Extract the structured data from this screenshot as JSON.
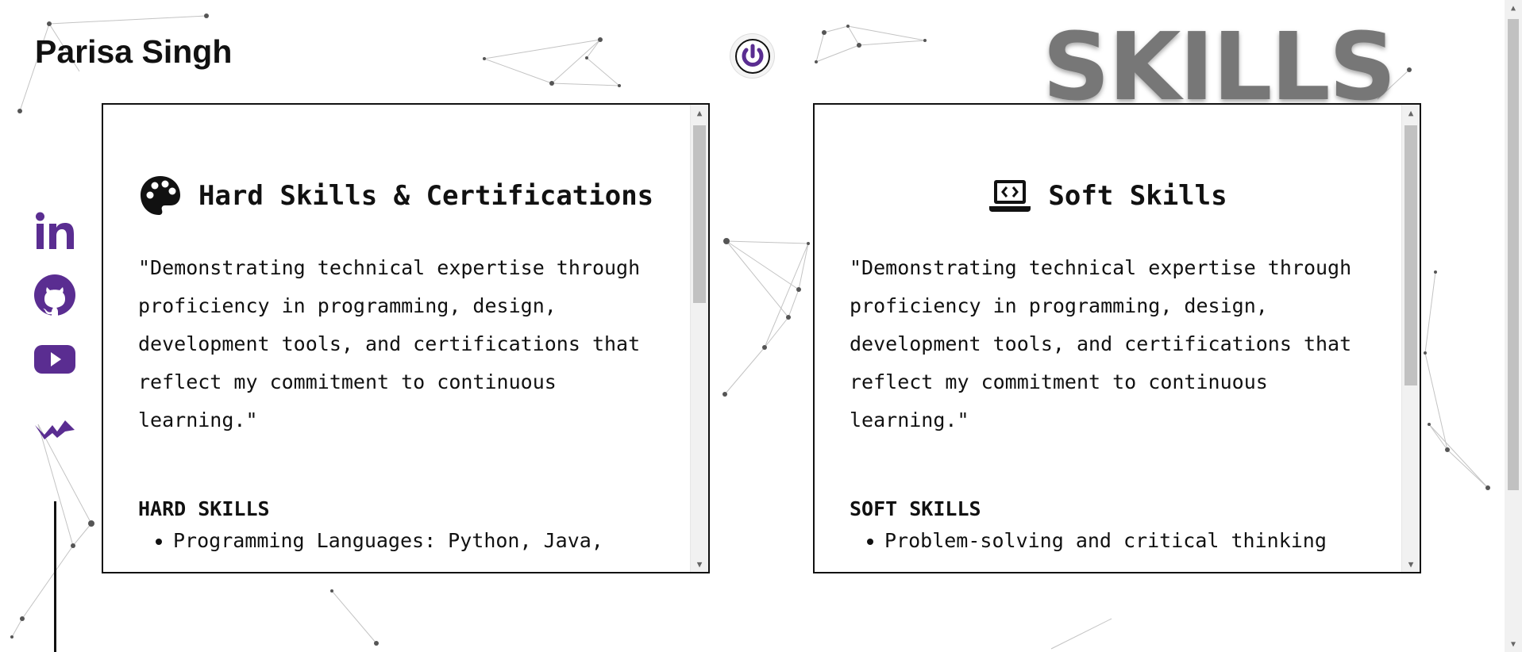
{
  "header": {
    "name": "Parisa Singh",
    "section_title": "SKILLS"
  },
  "colors": {
    "accent": "#5a2d91",
    "heading_gray": "#777777"
  },
  "social": [
    {
      "id": "linkedin",
      "icon": "linkedin-icon"
    },
    {
      "id": "github",
      "icon": "github-icon"
    },
    {
      "id": "youtube",
      "icon": "youtube-icon"
    },
    {
      "id": "wakatime",
      "icon": "zigzag-logo-icon"
    }
  ],
  "cards": [
    {
      "title": "Hard Skills & Certifications",
      "icon": "palette-icon",
      "quote": "\"Demonstrating technical expertise through proficiency in programming, design, development tools, and certifications that reflect my commitment to continuous learning.\"",
      "section_heading": "HARD SKILLS",
      "items": [
        "Programming Languages: Python, Java,"
      ]
    },
    {
      "title": "Soft Skills",
      "icon": "laptop-code-icon",
      "quote": "\"Demonstrating technical expertise through proficiency in programming, design, development tools, and certifications that reflect my commitment to continuous learning.\"",
      "section_heading": "SOFT SKILLS",
      "items": [
        "Problem-solving and critical thinking"
      ]
    }
  ]
}
